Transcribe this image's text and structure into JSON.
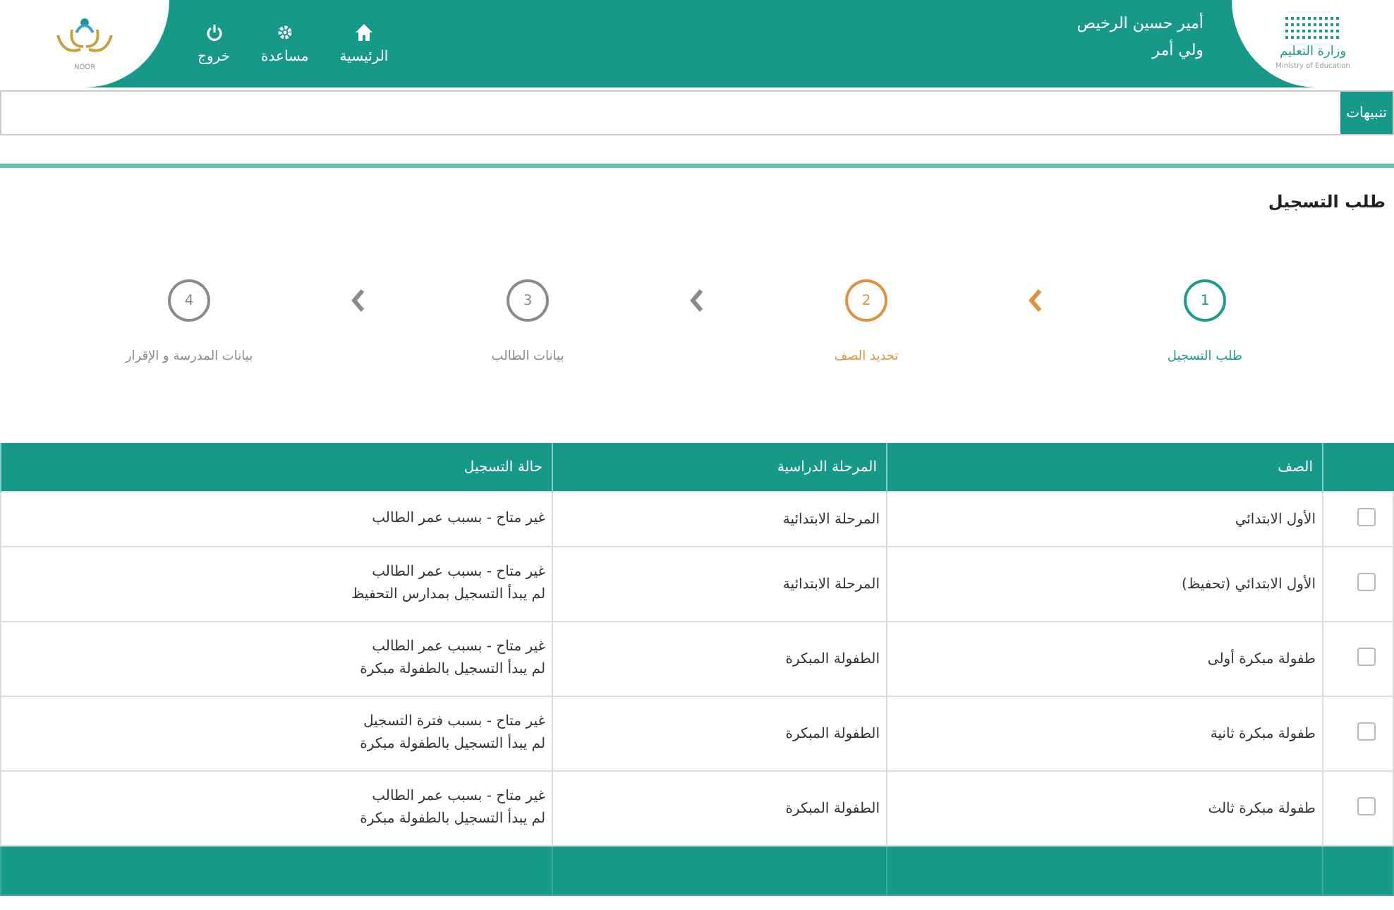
{
  "header": {
    "logo_text": "وزارة التعليم",
    "logo_subtext": "Ministry of Education",
    "user_name": "أمير حسين الرخيص",
    "user_role": "ولي أمر",
    "nav": [
      {
        "label": "الرئيسية",
        "kind": "home"
      },
      {
        "label": "مساعدة",
        "kind": "help"
      },
      {
        "label": "خروج",
        "kind": "logout"
      }
    ],
    "brand": "NOOR"
  },
  "notifications": {
    "label": "تنبيهات"
  },
  "page_title": "طلب التسجيل",
  "steps": [
    {
      "number": "1",
      "label": "طلب التسجيل",
      "kind": "done"
    },
    {
      "number": "2",
      "label": "تحديد الصف",
      "kind": "current"
    },
    {
      "number": "3",
      "label": "بيانات الطالب",
      "kind": "pending"
    },
    {
      "number": "4",
      "label": "بيانات المدرسة و الإقرار",
      "kind": "pending"
    }
  ],
  "table": {
    "columns": [
      "الصف",
      "المرحلة الدراسية",
      "حالة التسجيل"
    ],
    "rows": [
      {
        "checked": false,
        "grade": "الأول الابتدائي",
        "stage": "المرحلة الابتدائية",
        "status": [
          "غير متاح - بسبب عمر الطالب"
        ]
      },
      {
        "checked": false,
        "grade": "الأول الابتدائي (تحفيظ)",
        "stage": "المرحلة الابتدائية",
        "status": [
          "غير متاح - بسبب عمر الطالب",
          "لم يبدأ التسجيل بمدارس التحفيظ"
        ]
      },
      {
        "checked": false,
        "grade": "طفولة مبكرة أولى",
        "stage": "الطفولة المبكرة",
        "status": [
          "غير متاح - بسبب عمر الطالب",
          "لم يبدأ التسجيل بالطفولة مبكرة"
        ]
      },
      {
        "checked": false,
        "grade": "طفولة مبكرة ثانية",
        "stage": "الطفولة المبكرة",
        "status": [
          "غير متاح - بسبب فترة التسجيل",
          "لم يبدأ التسجيل بالطفولة مبكرة"
        ]
      },
      {
        "checked": false,
        "grade": "طفولة مبكرة ثالث",
        "stage": "الطفولة المبكرة",
        "status": [
          "غير متاح - بسبب عمر الطالب",
          "لم يبدأ التسجيل بالطفولة مبكرة"
        ]
      }
    ]
  }
}
